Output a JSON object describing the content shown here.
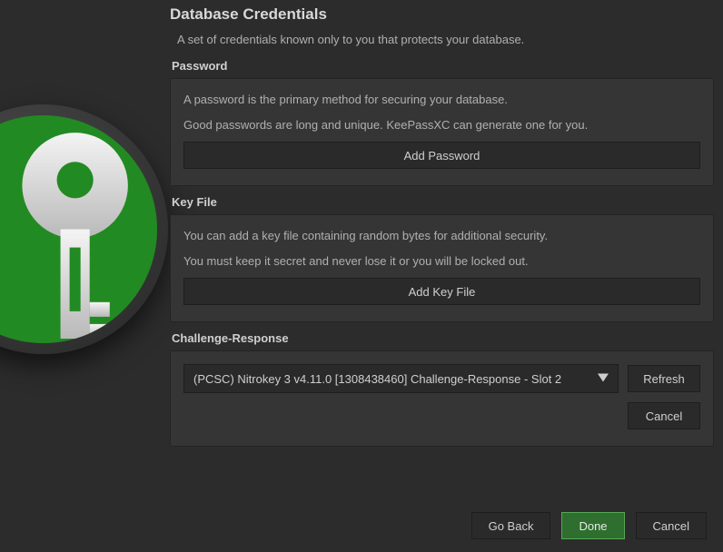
{
  "title": "Database Credentials",
  "subtitle": "A set of credentials known only to you that protects your database.",
  "password": {
    "label": "Password",
    "line1": "A password is the primary method for securing your database.",
    "line2": "Good passwords are long and unique. KeePassXC can generate one for you.",
    "button": "Add Password"
  },
  "keyfile": {
    "label": "Key File",
    "line1": "You can add a key file containing random bytes for additional security.",
    "line2": "You must keep it secret and never lose it or you will be locked out.",
    "button": "Add Key File"
  },
  "challenge": {
    "label": "Challenge-Response",
    "selected": "(PCSC) Nitrokey 3 v4.11.0 [1308438460] Challenge-Response - Slot 2",
    "refresh": "Refresh",
    "cancel": "Cancel"
  },
  "footer": {
    "back": "Go Back",
    "done": "Done",
    "cancel": "Cancel"
  }
}
